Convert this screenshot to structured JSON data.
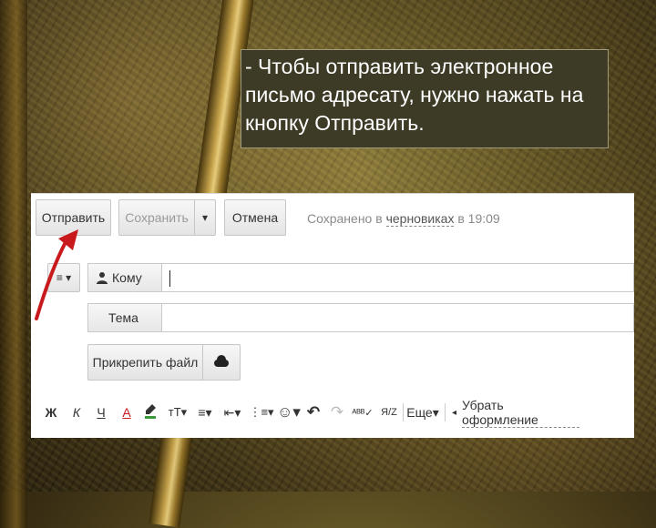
{
  "callout": {
    "text": "- Чтобы отправить электронное письмо адресату, нужно нажать на кнопку Отправить."
  },
  "toolbar": {
    "send_label": "Отправить",
    "save_label": "Сохранить",
    "save_dropdown": "▾",
    "cancel_label": "Отмена",
    "saved_prefix": "Сохранено в ",
    "saved_link": "черновиках",
    "saved_suffix": " в 19:09"
  },
  "compose": {
    "menu_glyph": "≡ ▾",
    "to_label": "Кому",
    "subject_label": "Тема",
    "attach_label": "Прикрепить файл"
  },
  "format": {
    "bold": "Ж",
    "italic": "К",
    "underline": "Ч",
    "text_color": "А",
    "font_size": "тТ▾",
    "align": "≡▾",
    "indent": "⇤▾",
    "list": "⋮≡▾",
    "emoji": "☺▾",
    "undo": "↶",
    "redo": "↷",
    "spellcheck": "ᴬᴮᴮ✓",
    "translit": "Я/Z",
    "more": "Еще▾",
    "clear_format": "Убрать оформление"
  },
  "colors": {
    "arrow": "#c8191c",
    "panel": "#ffffff",
    "callout_bg": "#3d3a26"
  }
}
